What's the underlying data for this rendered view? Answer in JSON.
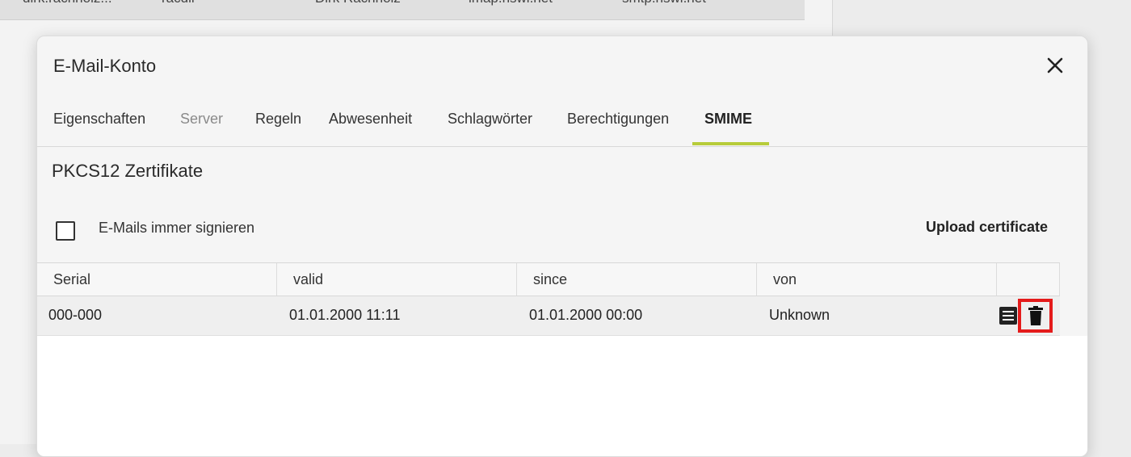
{
  "background": {
    "row": [
      "dirk.rachholz...",
      "racdir",
      "Dirk Rachholz",
      "imap.hswl.net",
      "smtp.hswl.net"
    ]
  },
  "dialog": {
    "title": "E-Mail-Konto",
    "close_icon": "close-icon",
    "tabs": [
      {
        "label": "Eigenschaften",
        "state": "normal"
      },
      {
        "label": "Server",
        "state": "disabled"
      },
      {
        "label": "Regeln",
        "state": "normal"
      },
      {
        "label": "Abwesenheit",
        "state": "normal"
      },
      {
        "label": "Schlagwörter",
        "state": "normal"
      },
      {
        "label": "Berechtigungen",
        "state": "normal"
      },
      {
        "label": "SMIME",
        "state": "active"
      }
    ],
    "accent_color": "#b7cc3a",
    "section_title": "PKCS12 Zertifikate",
    "sign_checkbox": {
      "label": "E-Mails immer signieren",
      "checked": false
    },
    "upload_label": "Upload certificate",
    "table": {
      "columns": [
        "Serial",
        "valid",
        "since",
        "von"
      ],
      "rows": [
        {
          "serial": "000-000",
          "valid": "01.01.2000 11:11",
          "since": "01.01.2000 00:00",
          "von": "Unknown",
          "actions": [
            "details-icon",
            "trash-icon"
          ]
        }
      ]
    },
    "highlight_color": "#e41b1b"
  }
}
